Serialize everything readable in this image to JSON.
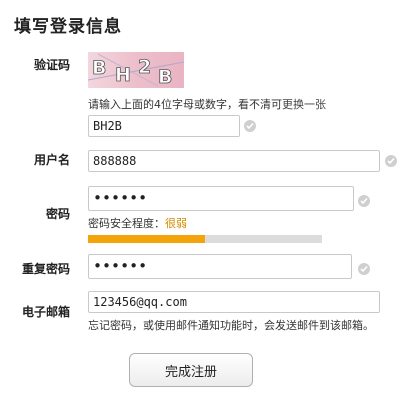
{
  "page": {
    "title": "填写登录信息"
  },
  "captcha": {
    "label": "验证码",
    "image_text": "BH2B",
    "hint_prefix": "请输入上面的4位字母或数字，看不清可",
    "refresh_link": "更换一张",
    "value": "BH2B"
  },
  "username": {
    "label": "用户名",
    "value": "888888"
  },
  "password": {
    "label": "密码",
    "value": "••••••",
    "strength_label": "密码安全程度：",
    "strength_value": "很弱",
    "strength_level": 0.5,
    "strength_color": "#f4a30a"
  },
  "confirm_password": {
    "label": "重复密码",
    "value": "••••••"
  },
  "email": {
    "label": "电子邮箱",
    "value": "123456@qq.com",
    "hint": "忘记密码，或使用邮件通知功能时，会发送邮件到该邮箱。"
  },
  "submit": {
    "label": "完成注册"
  },
  "icons": {
    "valid": "check-circle-icon"
  }
}
